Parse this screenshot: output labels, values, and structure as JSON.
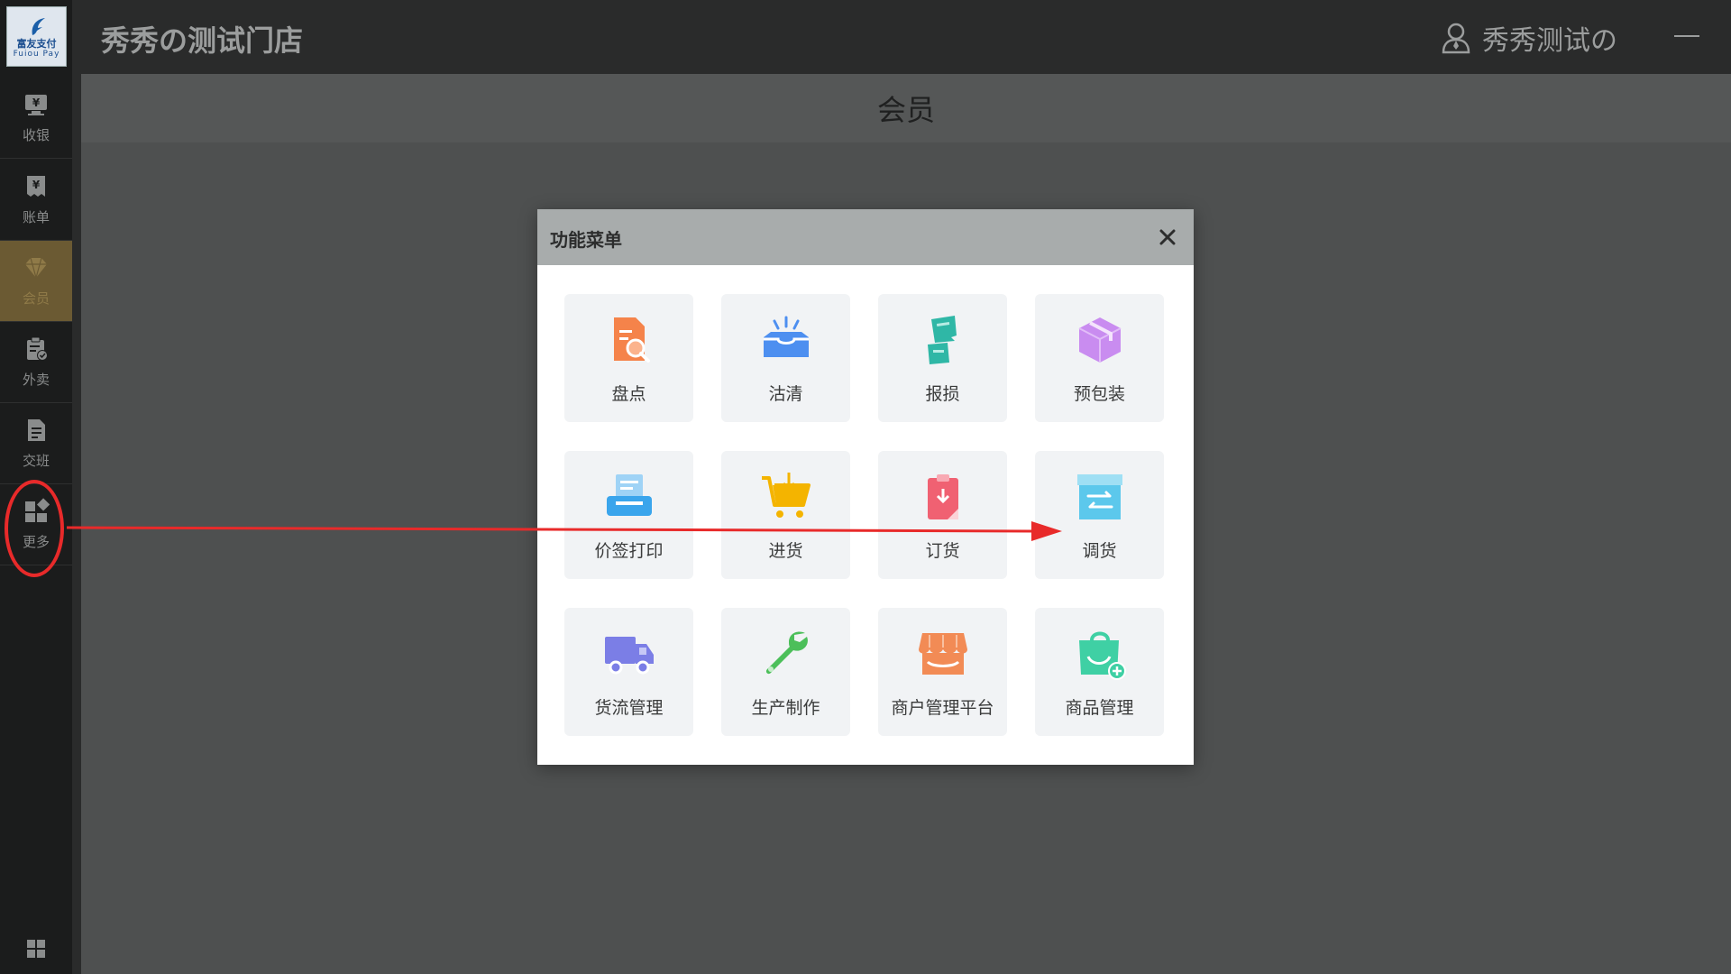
{
  "app": {
    "logo": {
      "text_cn": "富友支付",
      "text_en": "Fuiou Pay"
    },
    "store_name": "秀秀の测试门店",
    "user_name": "秀秀测试の"
  },
  "sidebar": {
    "items": [
      {
        "label": "收银",
        "icon": "cash-register-icon",
        "active": false
      },
      {
        "label": "账单",
        "icon": "bill-icon",
        "active": false
      },
      {
        "label": "会员",
        "icon": "diamond-icon",
        "active": true
      },
      {
        "label": "外卖",
        "icon": "clipboard-check-icon",
        "active": false
      },
      {
        "label": "交班",
        "icon": "document-icon",
        "active": false
      },
      {
        "label": "更多",
        "icon": "more-apps-icon",
        "active": false
      }
    ]
  },
  "main": {
    "section_title": "会员"
  },
  "dialog": {
    "title": "功能菜单",
    "tiles": [
      {
        "label": "盘点",
        "icon": "stock-take-icon",
        "color": "#f5834a"
      },
      {
        "label": "沽清",
        "icon": "sold-out-icon",
        "color": "#4d8ff0"
      },
      {
        "label": "报损",
        "icon": "damage-report-icon",
        "color": "#2fb7a6"
      },
      {
        "label": "预包装",
        "icon": "prepackage-box-icon",
        "color": "#c98cf0"
      },
      {
        "label": "价签打印",
        "icon": "label-print-icon",
        "color": "#3aa5ec"
      },
      {
        "label": "进货",
        "icon": "purchase-cart-icon",
        "color": "#f4b400"
      },
      {
        "label": "订货",
        "icon": "order-goods-icon",
        "color": "#f06172"
      },
      {
        "label": "调货",
        "icon": "transfer-goods-icon",
        "color": "#5cc8ec"
      },
      {
        "label": "货流管理",
        "icon": "truck-icon",
        "color": "#7b7ee6"
      },
      {
        "label": "生产制作",
        "icon": "wrench-icon",
        "color": "#4cbf5a"
      },
      {
        "label": "商户管理平台",
        "icon": "storefront-icon",
        "color": "#f28b55"
      },
      {
        "label": "商品管理",
        "icon": "shopping-bag-icon",
        "color": "#3fd0a4"
      }
    ]
  },
  "annotation": {
    "color": "#e82a2a"
  }
}
